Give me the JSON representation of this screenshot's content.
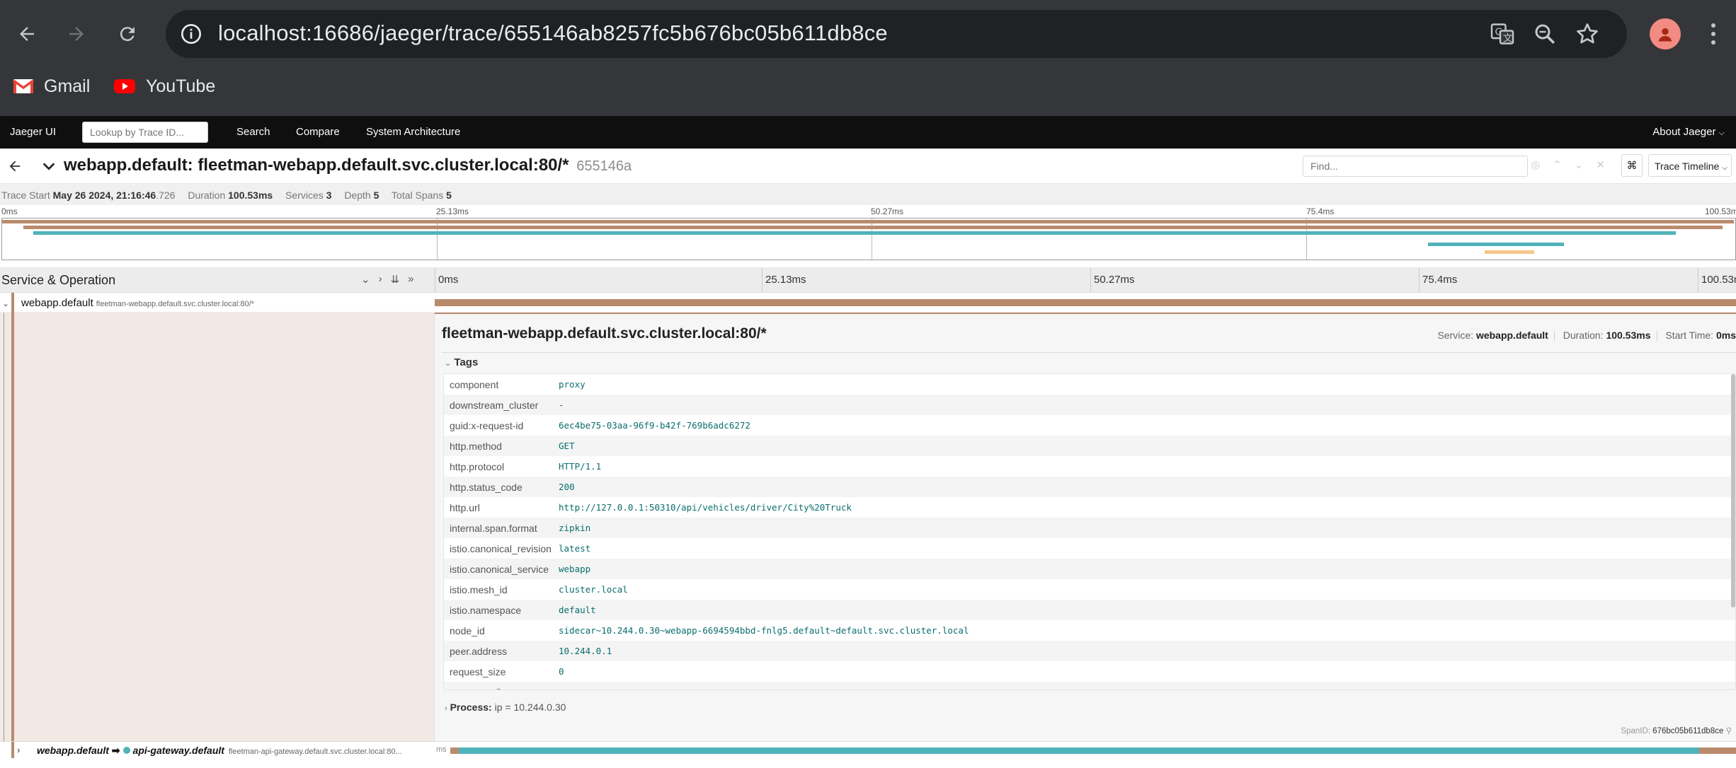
{
  "browser": {
    "url": "localhost:16686/jaeger/trace/655146ab8257fc5b676bc05b611db8ce",
    "bookmarks": [
      {
        "label": "Gmail",
        "icon": "gmail-icon"
      },
      {
        "label": "YouTube",
        "icon": "youtube-icon"
      }
    ],
    "icons": [
      "back-icon",
      "forward-icon",
      "reload-icon",
      "info-icon",
      "translate-icon",
      "zoom-icon",
      "star-icon",
      "profile-icon",
      "menu-icon"
    ]
  },
  "topnav": {
    "brand": "Jaeger UI",
    "lookup_placeholder": "Lookup by Trace ID...",
    "links": [
      "Search",
      "Compare",
      "System Architecture"
    ],
    "about": "About Jaeger"
  },
  "trace": {
    "title": "webapp.default: fleetman-webapp.default.svc.cluster.local:80/*",
    "short_id": "655146a",
    "find_placeholder": "Find...",
    "view_mode": "Trace Timeline",
    "meta": {
      "start_label": "Trace Start",
      "start_value": "May 26 2024, 21:16:46",
      "start_ms": ".726",
      "duration_label": "Duration",
      "duration_value": "100.53ms",
      "services_label": "Services",
      "services_value": "3",
      "depth_label": "Depth",
      "depth_value": "5",
      "spans_label": "Total Spans",
      "spans_value": "5"
    }
  },
  "ticks": [
    "0ms",
    "25.13ms",
    "50.27ms",
    "75.4ms",
    "100.53ms"
  ],
  "span_header": {
    "title": "Service & Operation"
  },
  "spans": {
    "root": {
      "service": "webapp.default",
      "operation": "fleetman-webapp.default.svc.cluster.local:80/*"
    },
    "child": {
      "service_from": "webapp.default",
      "arrow": "➡",
      "service_to": "api-gateway.default",
      "operation": "fleetman-api-gateway.default.svc.cluster.local:80...",
      "offset_label": "ms"
    }
  },
  "detail": {
    "operation": "fleetman-webapp.default.svc.cluster.local:80/*",
    "service_label": "Service:",
    "service_value": "webapp.default",
    "duration_label": "Duration:",
    "duration_value": "100.53ms",
    "start_label": "Start Time:",
    "start_value": "0ms",
    "tags_title": "Tags",
    "tags": [
      {
        "key": "component",
        "value": "proxy"
      },
      {
        "key": "downstream_cluster",
        "value": "-"
      },
      {
        "key": "guid:x-request-id",
        "value": "6ec4be75-03aa-96f9-b42f-769b6adc6272"
      },
      {
        "key": "http.method",
        "value": "GET"
      },
      {
        "key": "http.protocol",
        "value": "HTTP/1.1"
      },
      {
        "key": "http.status_code",
        "value": "200"
      },
      {
        "key": "http.url",
        "value": "http://127.0.0.1:50310/api/vehicles/driver/City%20Truck"
      },
      {
        "key": "internal.span.format",
        "value": "zipkin"
      },
      {
        "key": "istio.canonical_revision",
        "value": "latest"
      },
      {
        "key": "istio.canonical_service",
        "value": "webapp"
      },
      {
        "key": "istio.mesh_id",
        "value": "cluster.local"
      },
      {
        "key": "istio.namespace",
        "value": "default"
      },
      {
        "key": "node_id",
        "value": "sidecar~10.244.0.30~webapp-6694594bbd-fnlg5.default~default.svc.cluster.local"
      },
      {
        "key": "peer.address",
        "value": "10.244.0.1"
      },
      {
        "key": "request_size",
        "value": "0"
      },
      {
        "key": "response_flags",
        "value": ""
      }
    ],
    "process_label": "Process:",
    "process_value": "ip = 10.244.0.30",
    "spanid_label": "SpanID:",
    "spanid_value": "676bc05b611db8ce"
  },
  "colors": {
    "webapp": "#b98a6c",
    "api_gateway": "#4fb3b9",
    "other": "#f7c68a"
  }
}
